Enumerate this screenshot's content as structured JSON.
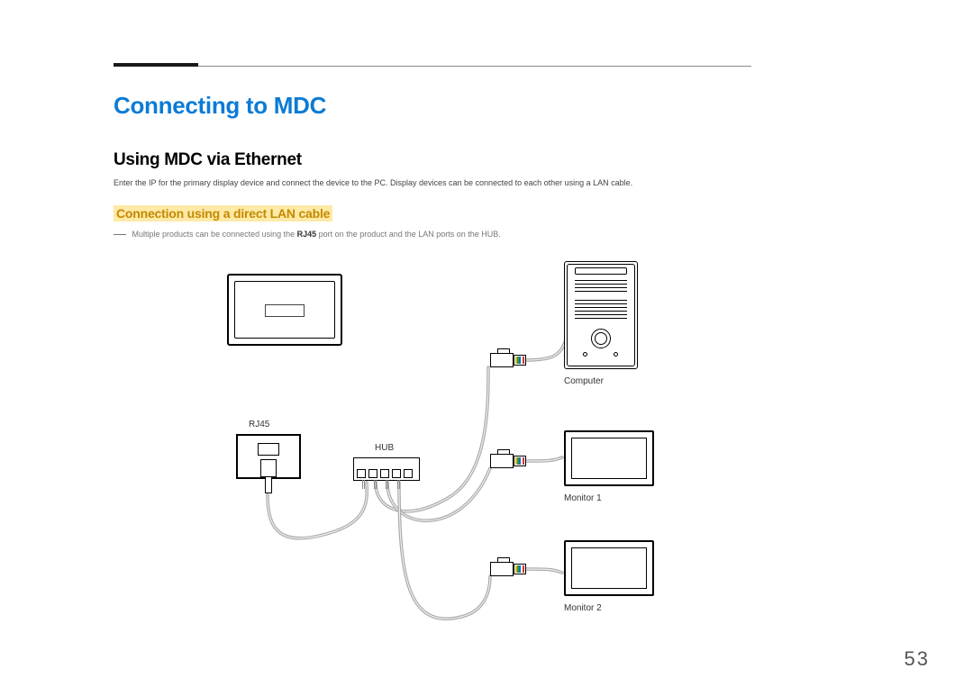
{
  "page_number": "53",
  "h1": "Connecting to MDC",
  "h2": "Using MDC via Ethernet",
  "body": "Enter the IP for the primary display device and connect the device to the PC. Display devices can be connected to each other using a LAN cable.",
  "h3": "Connection using a direct LAN cable",
  "note_prefix": "Multiple products can be connected using the ",
  "note_bold": "RJ45",
  "note_suffix": " port on the product and the LAN ports on the HUB.",
  "labels": {
    "rj45": "RJ45",
    "hub": "HUB",
    "computer": "Computer",
    "monitor1": "Monitor 1",
    "monitor2": "Monitor 2"
  }
}
